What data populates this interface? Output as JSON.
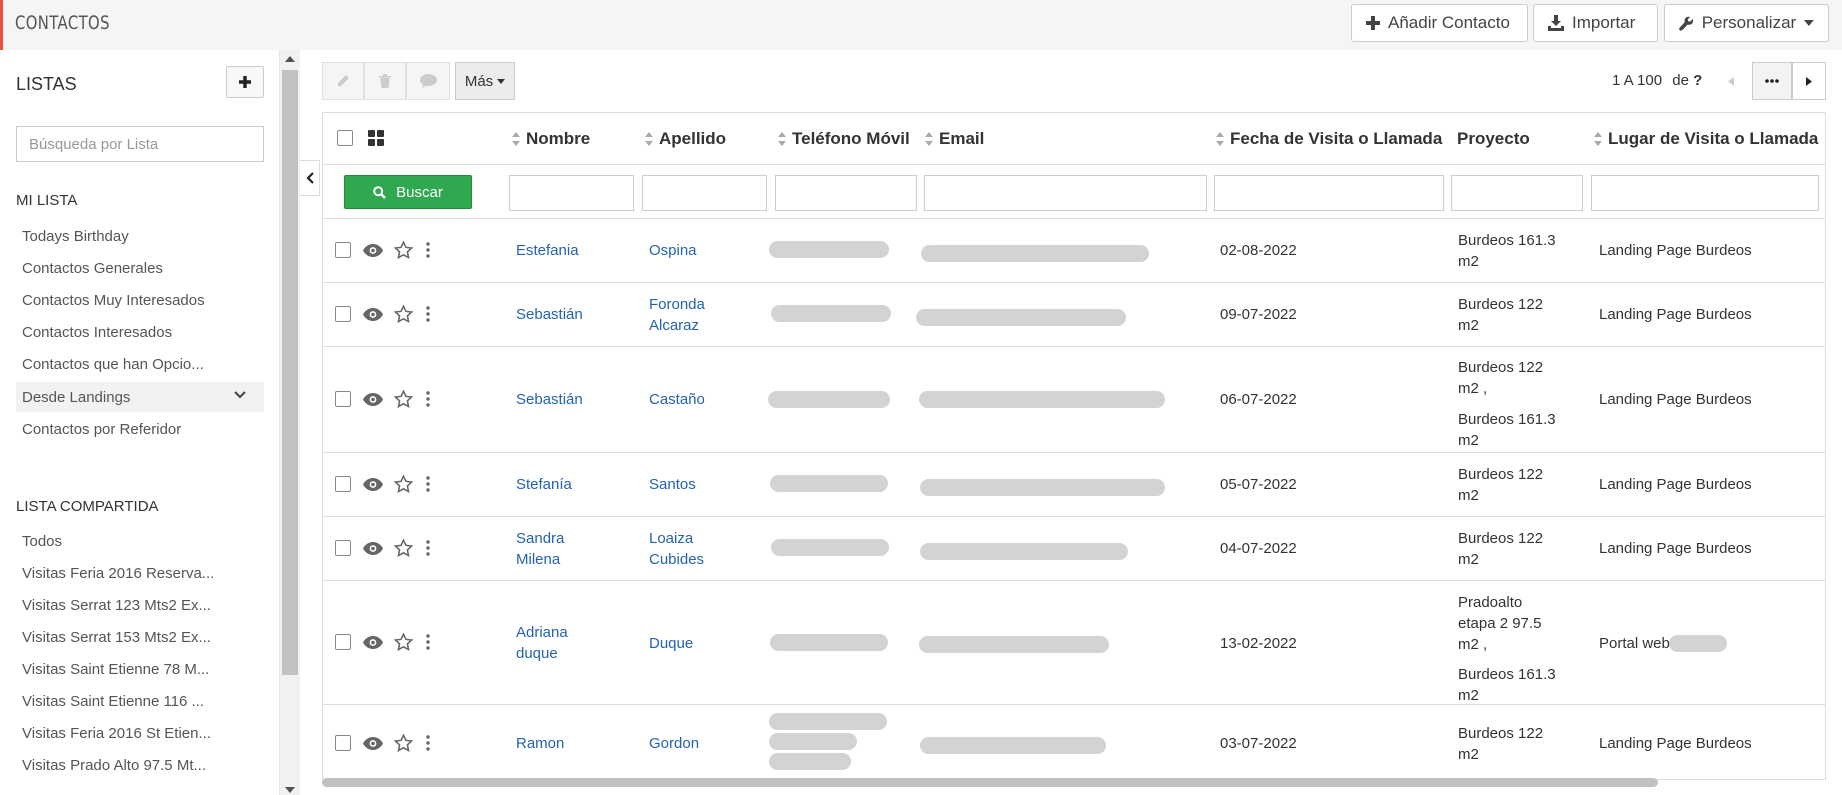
{
  "app": {
    "title": "CONTACTOS"
  },
  "topbar": {
    "add_contact": "Añadir Contacto",
    "import": "Importar",
    "customize": "Personalizar"
  },
  "sidebar": {
    "title": "LISTAS",
    "search_placeholder": "Búsqueda por Lista",
    "my_list_heading": "MI LISTA",
    "my_list": [
      "Todays Birthday",
      "Contactos Generales",
      "Contactos Muy Interesados",
      "Contactos Interesados",
      "Contactos que han Opcio...",
      "Desde Landings",
      "Contactos por Referidor"
    ],
    "shared_heading": "LISTA COMPARTIDA",
    "shared_list": [
      "Todos",
      "Visitas Feria 2016 Reserva...",
      "Visitas Serrat 123 Mts2 Ex...",
      "Visitas Serrat 153 Mts2 Ex...",
      "Visitas Saint Etienne 78 M...",
      "Visitas Saint Etienne 116 ...",
      "Visitas Feria 2016 St Etien...",
      "Visitas Prado Alto 97.5 Mt..."
    ]
  },
  "toolbar": {
    "more": "Más"
  },
  "pager": {
    "range": "1 A 100",
    "of": "de",
    "total": "?"
  },
  "search_button": "Buscar",
  "columns": [
    "Nombre",
    "Apellido",
    "Teléfono Móvil",
    "Email",
    "Fecha de Visita o Llamada",
    "Proyecto",
    "Lugar de Visita o Llamada"
  ],
  "rows": [
    {
      "nombre": "Estefania",
      "apellido": "Ospina",
      "fecha": "02-08-2022",
      "proyecto": [
        "Burdeos 161.3 m2"
      ],
      "lugar": "Landing Page Burdeos"
    },
    {
      "nombre": "Sebastián",
      "apellido": "Foronda Alcaraz",
      "fecha": "09-07-2022",
      "proyecto": [
        "Burdeos 122 m2"
      ],
      "lugar": "Landing Page Burdeos"
    },
    {
      "nombre": "Sebastián",
      "apellido": "Castaño",
      "fecha": "06-07-2022",
      "proyecto": [
        "Burdeos 122 m2 ,",
        "Burdeos 161.3 m2"
      ],
      "lugar": "Landing Page Burdeos"
    },
    {
      "nombre": "Stefanía",
      "apellido": "Santos",
      "fecha": "05-07-2022",
      "proyecto": [
        "Burdeos 122 m2"
      ],
      "lugar": "Landing Page Burdeos"
    },
    {
      "nombre": "Sandra Milena",
      "apellido": "Loaiza Cubides",
      "fecha": "04-07-2022",
      "proyecto": [
        "Burdeos 122 m2"
      ],
      "lugar": "Landing Page Burdeos"
    },
    {
      "nombre": "Adriana duque",
      "apellido": "Duque",
      "fecha": "13-02-2022",
      "proyecto": [
        "Pradoalto etapa 2 97.5 m2 ,",
        "Burdeos 161.3 m2"
      ],
      "lugar": "Portal web"
    },
    {
      "nombre": "Ramon",
      "apellido": "Gordon",
      "fecha": "03-07-2022",
      "proyecto": [
        "Burdeos 122 m2"
      ],
      "lugar": "Landing Page Burdeos"
    }
  ],
  "colors": {
    "accent": "#e8503e",
    "link": "#2563b0",
    "search_green": "#2fa84f"
  },
  "icons": [
    "plus-icon",
    "download-icon",
    "wrench-icon",
    "caret-down-icon",
    "pencil-icon",
    "trash-icon",
    "comment-icon",
    "eye-icon",
    "star-icon",
    "kebab-icon",
    "search-icon",
    "grid-icon",
    "chevron-left-icon",
    "chevron-right-icon",
    "ellipsis-icon"
  ]
}
